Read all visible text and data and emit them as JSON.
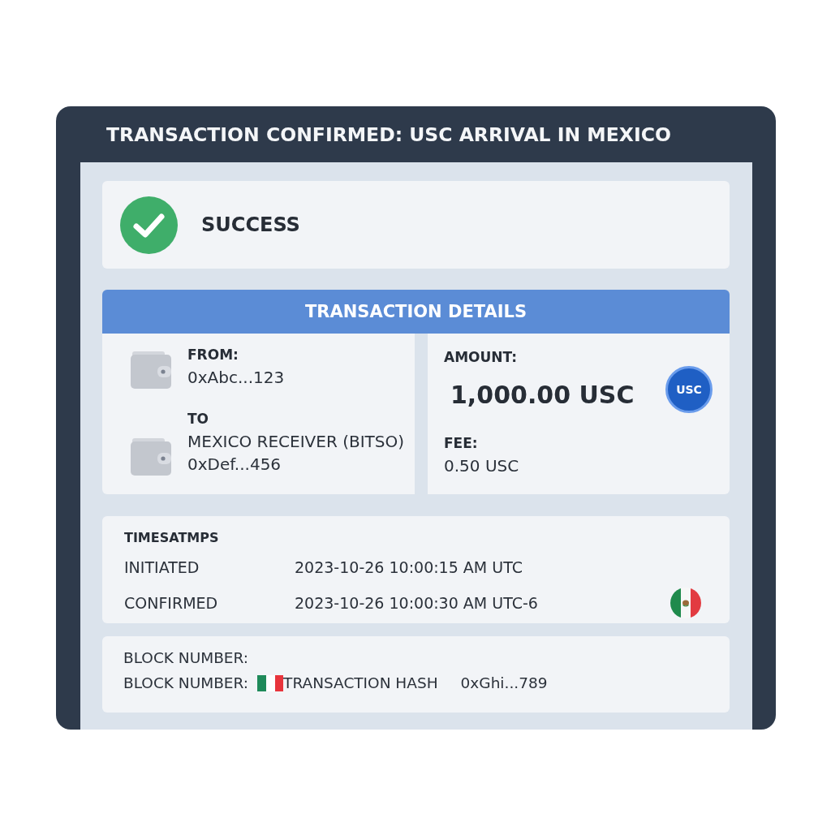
{
  "window": {
    "title": "TRANSACTION CONFIRMED: USC ARRIVAL IN MEXICO"
  },
  "status": {
    "kind": "success",
    "label": "SUCCESS"
  },
  "details": {
    "title": "TRANSACTION DETAILS",
    "parties": [
      {
        "label": "FROM:",
        "address": "0xAbc...123"
      },
      {
        "label": "TO",
        "name": "MEXICO RECEIVER (BITSO)",
        "address": "0xDef...456"
      }
    ],
    "amount": {
      "label": "AMOUNT:",
      "value": "1,000.00 USC",
      "token": "USC"
    },
    "fee": {
      "label": "FEE:",
      "value": "0.50 USC"
    }
  },
  "timestamps": {
    "title": "TIMESATMPS",
    "rows": [
      {
        "label": "INITIATED",
        "value": "2023-10-26 10:00:15 AM UTC",
        "flag": false
      },
      {
        "label": "CONFIRMED",
        "value": "2023-10-26 10:00:30 AM UTC-6",
        "flag": true
      }
    ]
  },
  "block": {
    "heading": "BLOCK NUMBER:",
    "label": "BLOCK NUMBER:",
    "hash_label": "TRANSACTION HASH",
    "hash": "0xGhi...789"
  }
}
